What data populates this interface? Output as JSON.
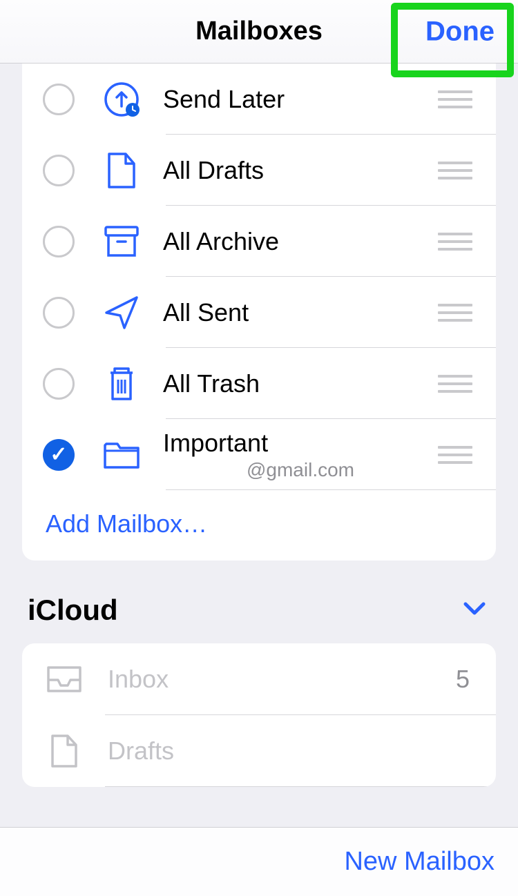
{
  "nav": {
    "title": "Mailboxes",
    "done": "Done"
  },
  "favorites": [
    {
      "label": "Send Later",
      "checked": false,
      "icon": "clock-up",
      "sub": ""
    },
    {
      "label": "All Drafts",
      "checked": false,
      "icon": "draft",
      "sub": ""
    },
    {
      "label": "All Archive",
      "checked": false,
      "icon": "archive",
      "sub": ""
    },
    {
      "label": "All Sent",
      "checked": false,
      "icon": "sent",
      "sub": ""
    },
    {
      "label": "All Trash",
      "checked": false,
      "icon": "trash",
      "sub": ""
    },
    {
      "label": "Important",
      "checked": true,
      "icon": "folder",
      "sub": "@gmail.com"
    }
  ],
  "add_mailbox": "Add Mailbox…",
  "account": {
    "name": "iCloud",
    "items": [
      {
        "label": "Inbox",
        "count": "5",
        "icon": "inbox"
      },
      {
        "label": "Drafts",
        "count": "",
        "icon": "draft-gray"
      }
    ]
  },
  "toolbar": {
    "new_mailbox": "New Mailbox"
  }
}
